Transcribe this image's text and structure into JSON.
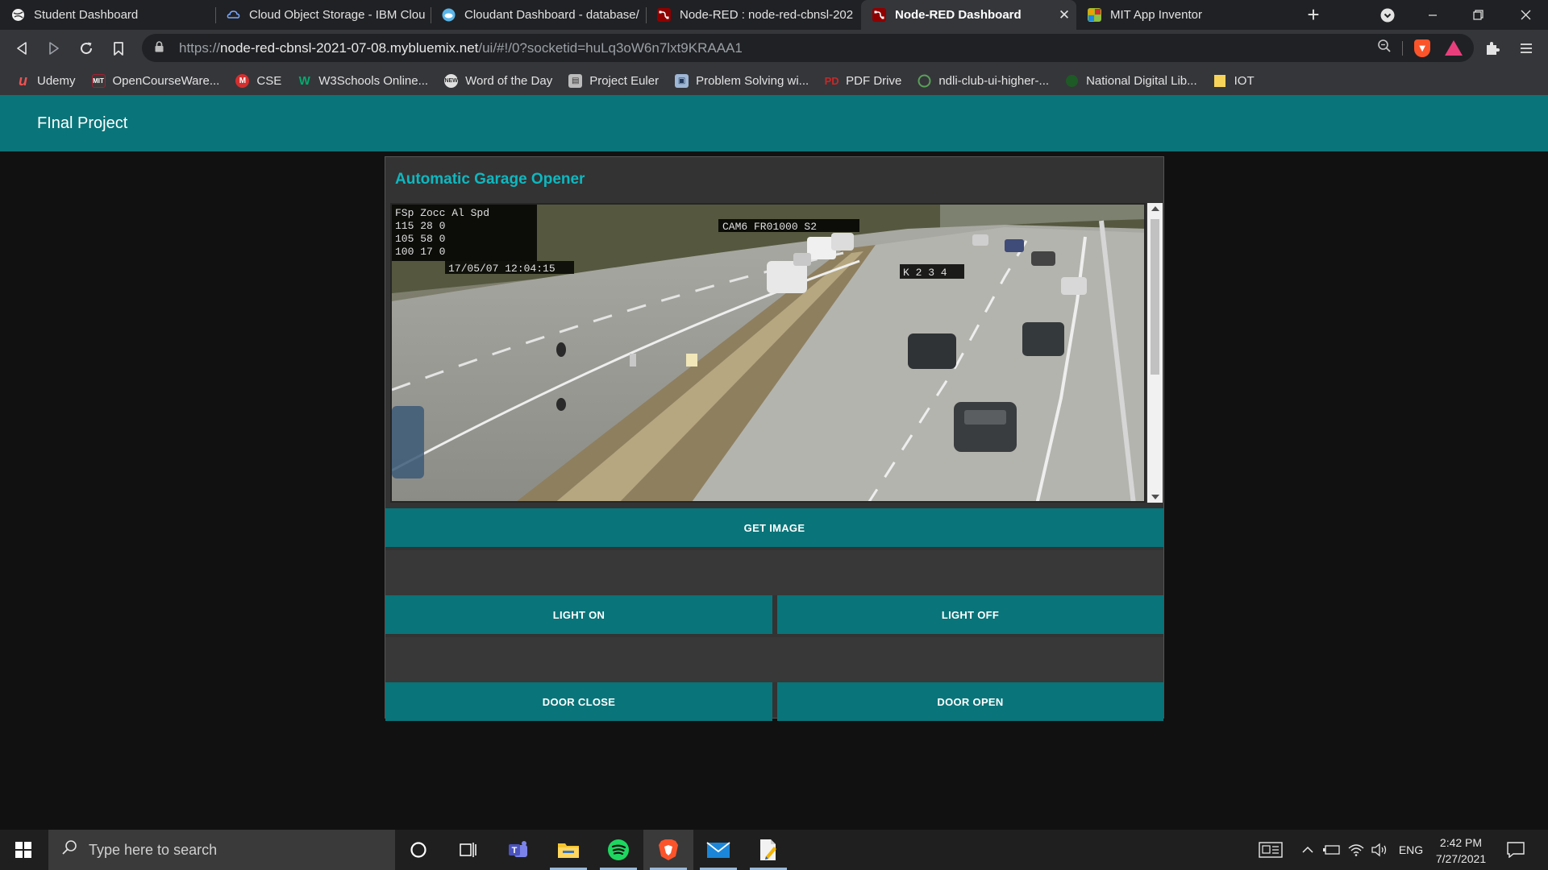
{
  "browser": {
    "tabs": [
      {
        "title": "Student Dashboard",
        "icon": "globe-icon",
        "color": "#9aa0a6"
      },
      {
        "title": "Cloud Object Storage - IBM Clou",
        "icon": "ibm-cloud-icon",
        "color": "#4589ff"
      },
      {
        "title": "Cloudant Dashboard - database/",
        "icon": "cloudant-icon",
        "color": "#2a8fd8"
      },
      {
        "title": "Node-RED : node-red-cbnsl-202",
        "icon": "node-red-icon",
        "color": "#8f0000"
      },
      {
        "title": "Node-RED Dashboard",
        "icon": "node-red-icon",
        "color": "#8f0000",
        "active": true
      },
      {
        "title": "MIT App Inventor",
        "icon": "app-inventor-icon",
        "color": "#96bd2b"
      }
    ],
    "close_glyph": "✕",
    "new_tab_glyph": "+",
    "url": {
      "scheme": "https://",
      "host": "node-red-cbnsl-2021-07-08.mybluemix.net",
      "path": "/ui/#!/0?socketid=huLq3oW6n7lxt9KRAAA1"
    },
    "bookmarks": [
      {
        "label": "Udemy",
        "icon": "udemy-icon",
        "color": "#ec5252",
        "glyph": "u"
      },
      {
        "label": "OpenCourseWare...",
        "icon": "mit-ocw-icon",
        "color": "#a31f34",
        "glyph": "MIT"
      },
      {
        "label": "CSE",
        "icon": "cse-icon",
        "color": "#d32f2f",
        "glyph": "M"
      },
      {
        "label": "W3Schools Online...",
        "icon": "w3schools-icon",
        "color": "#04aa6d",
        "glyph": "W"
      },
      {
        "label": "Word of the Day",
        "icon": "word-of-day-icon",
        "color": "#e0e0e0",
        "glyph": "N"
      },
      {
        "label": "Project Euler",
        "icon": "project-euler-icon",
        "color": "#bbbbbb",
        "glyph": "P"
      },
      {
        "label": "Problem Solving wi...",
        "icon": "problem-solving-icon",
        "color": "#9fb7d6",
        "glyph": "R"
      },
      {
        "label": "PDF Drive",
        "icon": "pdf-drive-icon",
        "color": "#c62828",
        "glyph": "D"
      },
      {
        "label": "ndli-club-ui-higher-...",
        "icon": "ndli-icon",
        "color": "#5aa05a",
        "glyph": "◯"
      },
      {
        "label": "National Digital Lib...",
        "icon": "ndl-icon",
        "color": "#2e7d32",
        "glyph": "●"
      },
      {
        "label": "IOT",
        "icon": "folder-icon",
        "color": "#f7d35a",
        "glyph": ""
      }
    ]
  },
  "dashboard": {
    "title": "FInal Project",
    "group_title": "Automatic Garage Opener",
    "buttons": {
      "get_image": "GET IMAGE",
      "light_on": "LIGHT ON",
      "light_off": "LIGHT OFF",
      "door_close": "DOOR CLOSE",
      "door_open": "DOOR OPEN"
    },
    "camera": {
      "overlay_line1": "FSp Zocc Al Spd",
      "overlay_line2": "115  28  0",
      "overlay_line3": "105  58  0",
      "overlay_line4": "100  17  0",
      "overlay_timestamp": "17/05/07 12:04:15",
      "overlay_cam_id": "CAM6 FR01000 S2",
      "overlay_counter": "K 2 3 4"
    },
    "colors": {
      "accent": "#097479",
      "title": "#0eb8c0",
      "group_bg": "#333333",
      "page_bg": "#111111"
    }
  },
  "taskbar": {
    "search_placeholder": "Type here to search",
    "clock_time": "2:42 PM",
    "clock_date": "7/27/2021",
    "language": "ENG"
  }
}
